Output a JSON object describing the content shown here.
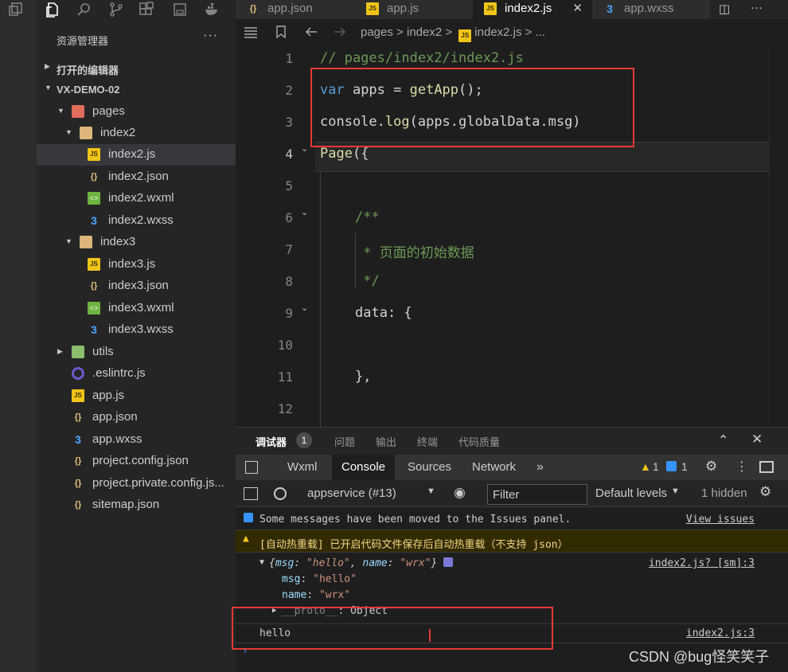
{
  "sidebar": {
    "title": "资源管理器",
    "more": "···",
    "sections": [
      {
        "label": "打开的编辑器"
      },
      {
        "label": "VX-DEMO-02"
      }
    ],
    "tree": [
      {
        "name": "pages"
      },
      {
        "name": "index2"
      },
      {
        "name": "index2.js"
      },
      {
        "name": "index2.json"
      },
      {
        "name": "index2.wxml"
      },
      {
        "name": "index2.wxss"
      },
      {
        "name": "index3"
      },
      {
        "name": "index3.js"
      },
      {
        "name": "index3.json"
      },
      {
        "name": "index3.wxml"
      },
      {
        "name": "index3.wxss"
      },
      {
        "name": "utils"
      },
      {
        "name": ".eslintrc.js"
      },
      {
        "name": "app.js"
      },
      {
        "name": "app.json"
      },
      {
        "name": "app.wxss"
      },
      {
        "name": "project.config.json"
      },
      {
        "name": "project.private.config.js..."
      },
      {
        "name": "sitemap.json"
      }
    ]
  },
  "tabs": [
    {
      "label": "app.json",
      "icon": "json-icon"
    },
    {
      "label": "app.js",
      "icon": "js-icon"
    },
    {
      "label": "index2.js",
      "icon": "js-icon",
      "active": true
    },
    {
      "label": "app.wxss",
      "icon": "wxss-icon"
    }
  ],
  "breadcrumb": {
    "parts": [
      "pages",
      ">",
      "index2",
      ">",
      "index2.js",
      "> ..."
    ]
  },
  "editor": {
    "line_numbers": [
      "1",
      "2",
      "3",
      "4",
      "5",
      "6",
      "7",
      "8",
      "9",
      "10",
      "11",
      "12"
    ],
    "current_line": "4",
    "lines": [
      {
        "num": "1",
        "text": "// pages/index2/index2.js"
      },
      {
        "num": "2",
        "var": "var",
        "name": " apps = ",
        "fn": "getApp",
        "rest": "();"
      },
      {
        "num": "3",
        "obj": "console.",
        "fn": "log",
        "rest": "(apps.globalData.msg)"
      },
      {
        "num": "4",
        "fn": "Page",
        "rest": "({"
      },
      {
        "num": "6",
        "text": "/**"
      },
      {
        "num": "7",
        "text": " * 页面的初始数据"
      },
      {
        "num": "8",
        "text": " */"
      },
      {
        "num": "9",
        "text": "data: {"
      },
      {
        "num": "11",
        "text": "},"
      }
    ]
  },
  "panel": {
    "tabs": [
      "调试器",
      "问题",
      "输出",
      "终端",
      "代码质量"
    ],
    "badge": "1",
    "devtools_tabs": [
      "Wxml",
      "Console",
      "Sources",
      "Network"
    ],
    "more": "»",
    "warn_count": "1",
    "info_count": "1",
    "context": "appservice (#13)",
    "filter_placeholder": "Filter",
    "levels": "Default levels",
    "hidden": "1 hidden",
    "messages": {
      "issues": "Some messages have been moved to the Issues panel.",
      "issues_link": "View issues",
      "warn": "[自动热重载] 已开启代码文件保存后自动热重载（不支持 json）",
      "obj_summary_open": "{",
      "obj_summary_k1": "msg",
      "obj_summary_v1": "\"hello\"",
      "obj_summary_k2": "name",
      "obj_summary_v2": "\"wrx\"",
      "obj_summary_close": "}",
      "obj_src": "index2.js? [sm]:3",
      "msg_key": "msg",
      "msg_val": "\"hello\"",
      "name_key": "name",
      "name_val": "\"wrx\"",
      "proto_key": "__proto__",
      "proto_val": ": Object",
      "hello": "hello",
      "hello_src": "index2.js:3"
    }
  },
  "watermark": "CSDN @bug怪笑笑子"
}
